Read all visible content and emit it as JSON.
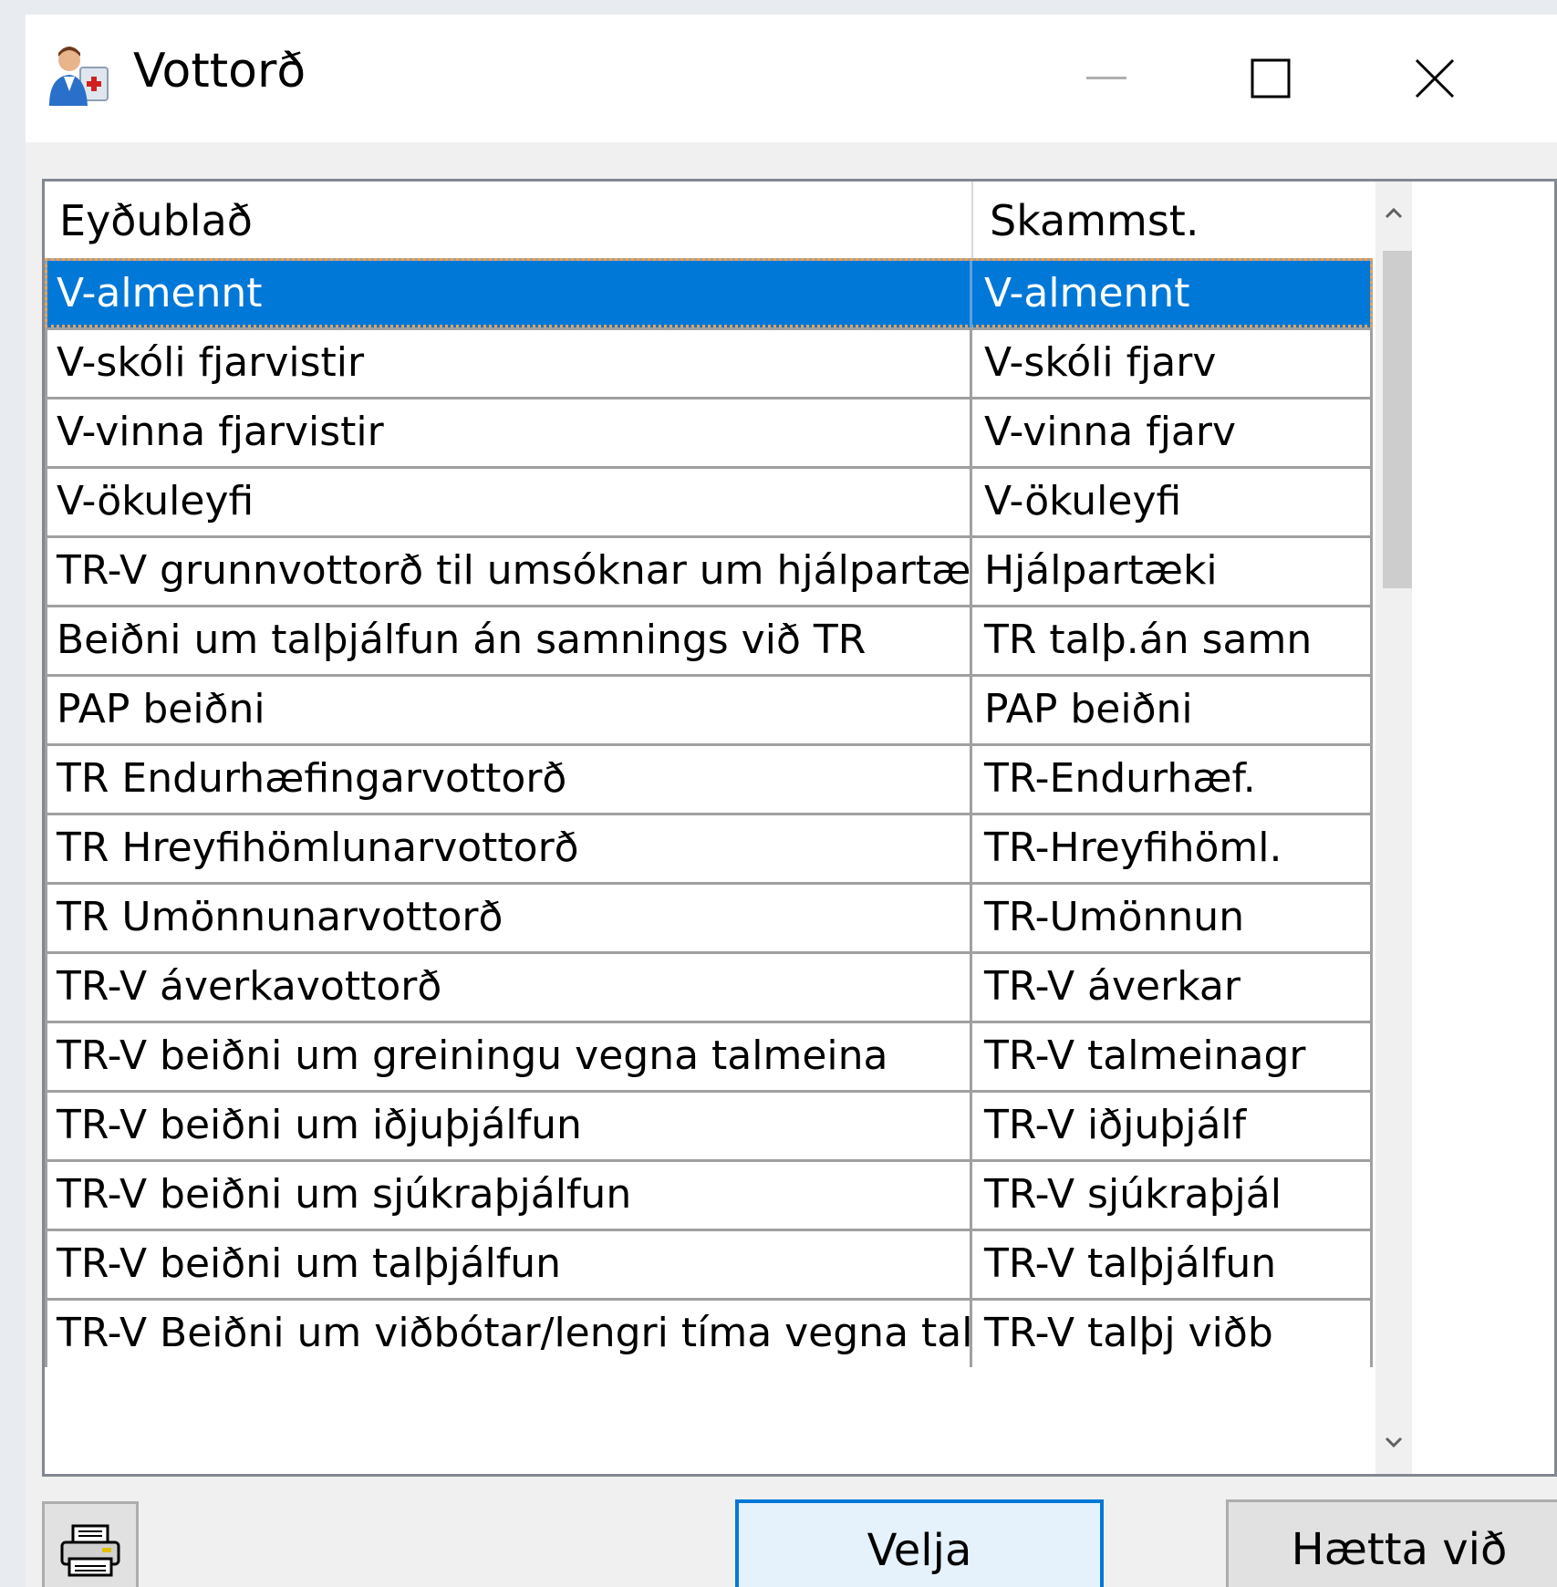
{
  "window": {
    "title": "Vottorð",
    "app_icon": "doctor-person-icon",
    "controls": [
      "minimize-icon",
      "maximize-icon",
      "close-icon"
    ]
  },
  "grid": {
    "columns": [
      "Eyðublað",
      "Skammst."
    ],
    "rows": [
      {
        "form": "V-almennt",
        "abbr": "V-almennt",
        "selected": true
      },
      {
        "form": "V-skóli fjarvistir",
        "abbr": "V-skóli fjarv"
      },
      {
        "form": "V-vinna fjarvistir",
        "abbr": "V-vinna fjarv"
      },
      {
        "form": "V-ökuleyfi",
        "abbr": "V-ökuleyfi"
      },
      {
        "form": "TR-V grunnvottorð til umsóknar um hjálpartæki",
        "abbr": "Hjálpartæki"
      },
      {
        "form": "Beiðni um talþjálfun án samnings við TR",
        "abbr": "TR talþ.án samn"
      },
      {
        "form": "PAP beiðni",
        "abbr": "PAP beiðni"
      },
      {
        "form": "TR Endurhæfingarvottorð",
        "abbr": "TR-Endurhæf."
      },
      {
        "form": "TR Hreyfihömlunarvottorð",
        "abbr": "TR-Hreyfihöml."
      },
      {
        "form": "TR Umönnunarvottorð",
        "abbr": "TR-Umönnun"
      },
      {
        "form": "TR-V áverkavottorð",
        "abbr": "TR-V áverkar"
      },
      {
        "form": "TR-V beiðni um greiningu vegna talmeina",
        "abbr": "TR-V talmeinagr"
      },
      {
        "form": "TR-V beiðni um iðjuþjálfun",
        "abbr": "TR-V iðjuþjálf"
      },
      {
        "form": "TR-V beiðni um sjúkraþjálfun",
        "abbr": "TR-V sjúkraþjál"
      },
      {
        "form": "TR-V beiðni um talþjálfun",
        "abbr": "TR-V talþjálfun"
      },
      {
        "form": "TR-V Beiðni um viðbótar/lengri tíma vegna talþjálf",
        "abbr": "TR-V talþj viðb"
      }
    ]
  },
  "buttons": {
    "print_icon": "printer-icon",
    "select_label": "Velja",
    "cancel_label": "Hætta við"
  },
  "colors": {
    "selection": "#0078d7",
    "default_button_border": "#0078d7"
  }
}
